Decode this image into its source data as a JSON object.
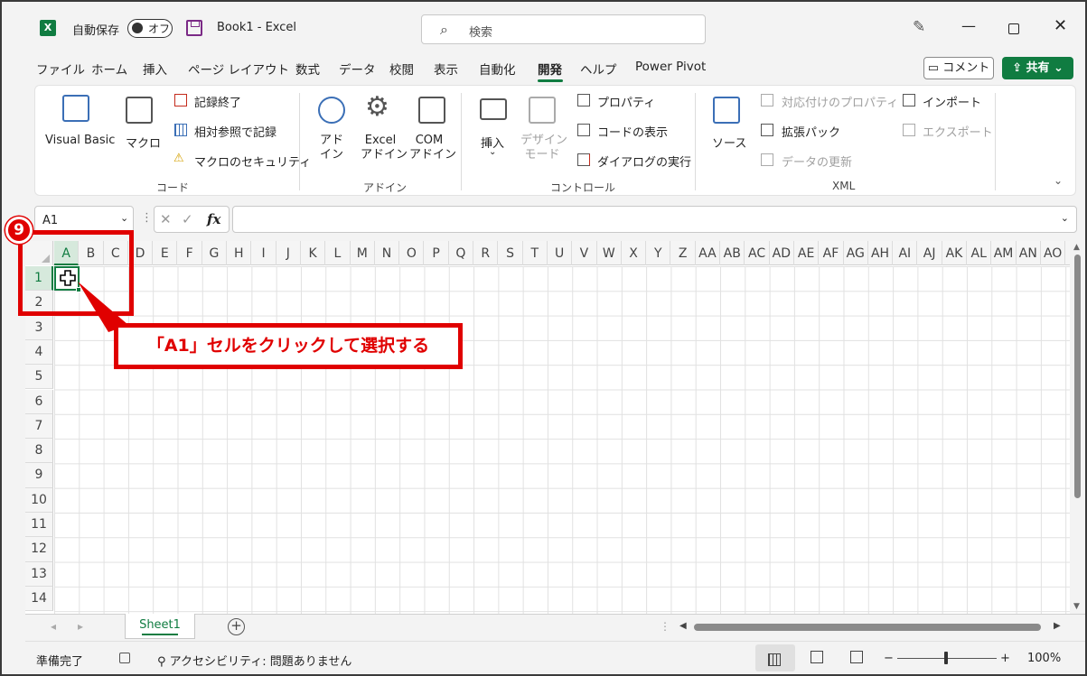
{
  "titlebar": {
    "app_icon": "excel-icon",
    "autosave_label": "自動保存",
    "autosave_state": "オフ",
    "book_title": "Book1  -  Excel",
    "search_placeholder": "検索",
    "pen_icon": "pen-icon",
    "min_glyph": "—",
    "close_glyph": "✕"
  },
  "menu": {
    "tabs": [
      "ファイル",
      "ホーム",
      "挿入",
      "ページ レイアウト",
      "数式",
      "データ",
      "校閲",
      "表示",
      "自動化",
      "開発",
      "ヘルプ",
      "Power Pivot"
    ],
    "active_tab": "開発",
    "comment_label": "コメント",
    "share_label": "共有"
  },
  "ribbon": {
    "code": {
      "label": "コード",
      "visual_basic": "Visual Basic",
      "macro": "マクロ",
      "stop_recording": "記録終了",
      "relative_ref": "相対参照で記録",
      "macro_security": "マクロのセキュリティ"
    },
    "addins": {
      "label": "アドイン",
      "addin_line1": "アド",
      "addin_line2": "イン",
      "excel_addin_line1": "Excel",
      "excel_addin_line2": "アドイン",
      "com_addin_line1": "COM",
      "com_addin_line2": "アドイン"
    },
    "controls": {
      "label": "コントロール",
      "insert": "挿入",
      "design_mode_line1": "デザイン",
      "design_mode_line2": "モード",
      "properties": "プロパティ",
      "view_code": "コードの表示",
      "run_dialog": "ダイアログの実行"
    },
    "xml": {
      "label": "XML",
      "source": "ソース",
      "map_properties": "対応付けのプロパティ",
      "expansion_packs": "拡張パック",
      "refresh_data": "データの更新",
      "import": "インポート",
      "export": "エクスポート"
    }
  },
  "formula_bar": {
    "name_box": "A1",
    "cancel_glyph": "✕",
    "enter_glyph": "✓",
    "fx": "fx",
    "formula": ""
  },
  "grid": {
    "columns": [
      "A",
      "B",
      "C",
      "D",
      "E",
      "F",
      "G",
      "H",
      "I",
      "J",
      "K",
      "L",
      "M",
      "N",
      "O",
      "P",
      "Q",
      "R",
      "S",
      "T",
      "U",
      "V",
      "W",
      "X",
      "Y",
      "Z",
      "AA",
      "AB",
      "AC",
      "AD",
      "AE",
      "AF",
      "AG",
      "AH",
      "AI",
      "AJ",
      "AK",
      "AL",
      "AM",
      "AN",
      "AO"
    ],
    "rows": [
      "1",
      "2",
      "3",
      "4",
      "5",
      "6",
      "7",
      "8",
      "9",
      "10",
      "11",
      "12",
      "13",
      "14"
    ],
    "active_cell": "A1"
  },
  "sheets": {
    "tabs": [
      "Sheet1"
    ],
    "add_glyph": "+"
  },
  "status": {
    "ready": "準備完了",
    "accessibility": "アクセシビリティ: 問題ありません",
    "zoom": "100%",
    "zoom_minus": "−",
    "zoom_plus": "+"
  },
  "annotation": {
    "step": "9",
    "callout": "「A1」セルをクリックして選択する",
    "color": "#e00000"
  },
  "colors": {
    "accent": "#107c41"
  }
}
